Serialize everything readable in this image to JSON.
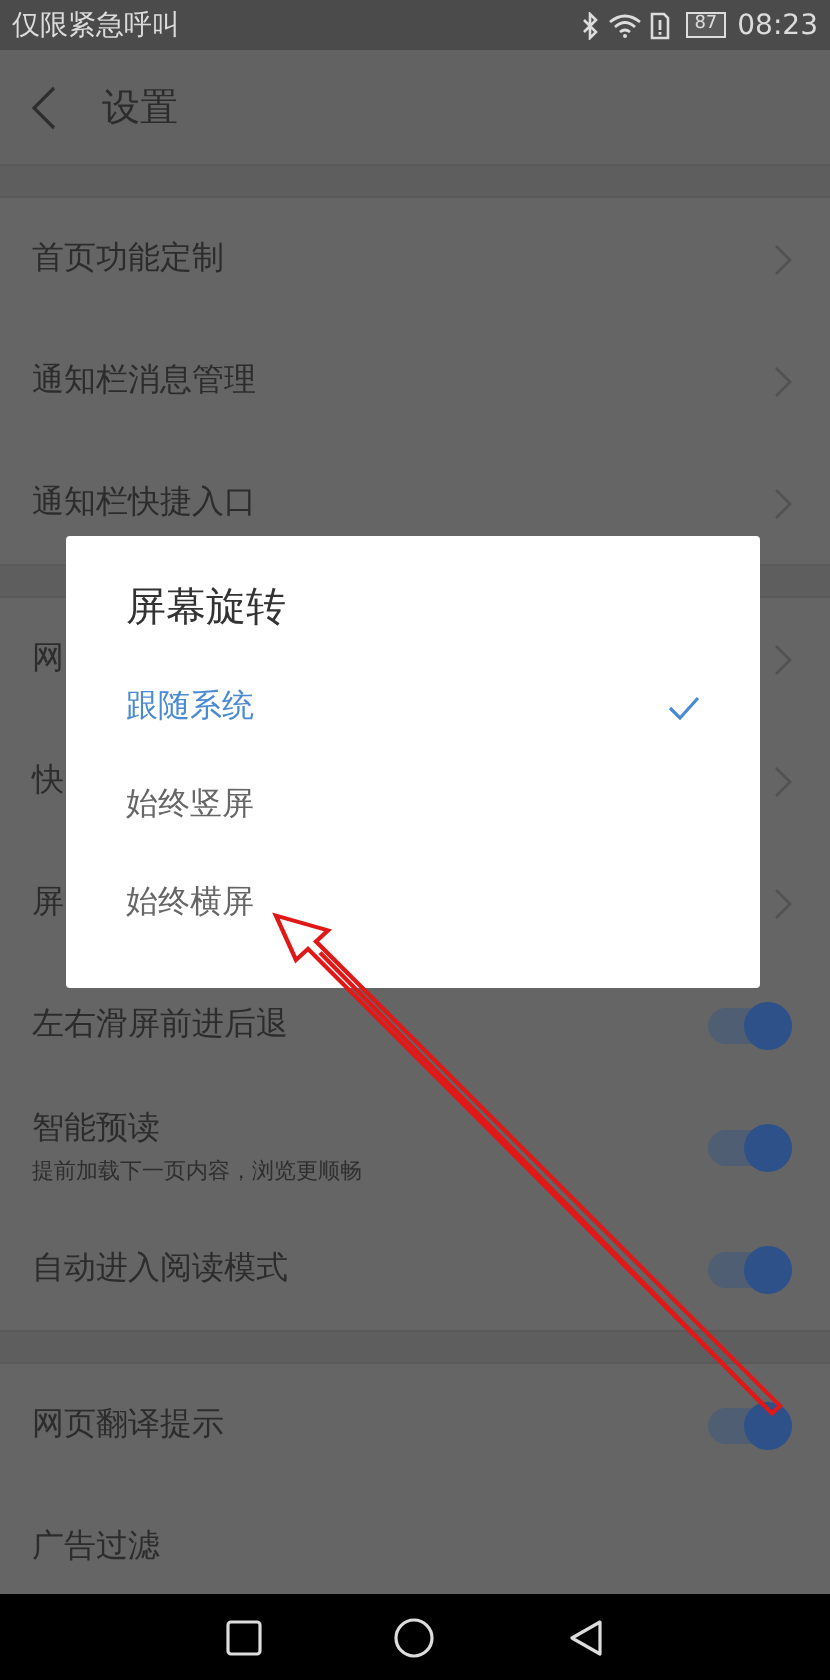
{
  "status_bar": {
    "carrier": "仅限紧急呼叫",
    "battery": "87",
    "time": "08:23"
  },
  "header": {
    "title": "设置"
  },
  "sections": [
    {
      "rows": [
        {
          "kind": "link",
          "label": "首页功能定制"
        },
        {
          "kind": "link",
          "label": "通知栏消息管理"
        },
        {
          "kind": "link",
          "label": "通知栏快捷入口"
        }
      ]
    },
    {
      "rows": [
        {
          "kind": "link",
          "label": "网"
        },
        {
          "kind": "link",
          "label": "快"
        },
        {
          "kind": "link",
          "label": "屏"
        },
        {
          "kind": "toggle",
          "label": "左右滑屏前进后退",
          "on": true
        },
        {
          "kind": "toggle",
          "label": "智能预读",
          "description": "提前加载下一页内容，浏览更顺畅",
          "on": true
        },
        {
          "kind": "toggle",
          "label": "自动进入阅读模式",
          "on": true
        }
      ]
    },
    {
      "rows": [
        {
          "kind": "toggle",
          "label": "网页翻译提示",
          "on": true
        },
        {
          "kind": "plain",
          "label": "广告过滤"
        }
      ]
    }
  ],
  "dialog": {
    "title": "屏幕旋转",
    "options": [
      {
        "label": "跟随系统",
        "selected": true
      },
      {
        "label": "始终竖屏",
        "selected": false
      },
      {
        "label": "始终横屏",
        "selected": false
      }
    ]
  }
}
